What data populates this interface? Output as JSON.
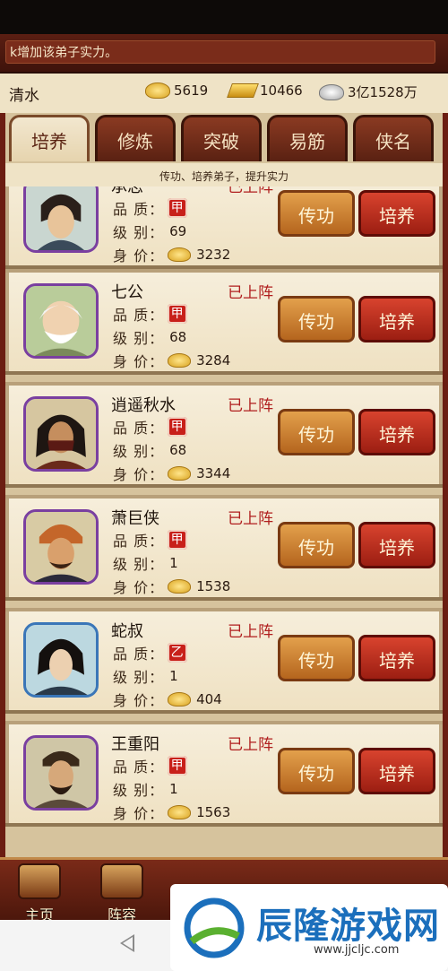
{
  "ticker": {
    "text": "k增加该弟子实力。"
  },
  "status": {
    "player_name": "清水",
    "gold_ingot": "5619",
    "gold_bar": "10466",
    "silver": "3亿1528万"
  },
  "tabs": [
    {
      "label": "培养",
      "active": true
    },
    {
      "label": "修炼"
    },
    {
      "label": "突破"
    },
    {
      "label": "易筋"
    },
    {
      "label": "侠名"
    }
  ],
  "subtitle": "传功、培养弟子，提升实力",
  "labels": {
    "quality": "品 质：",
    "level": "级 别：",
    "price": "身 价：",
    "transfer_btn": "传功",
    "train_btn": "培养"
  },
  "characters": [
    {
      "name": "承志",
      "status": "已上阵",
      "quality": "甲",
      "level": "69",
      "price": "3232"
    },
    {
      "name": "七公",
      "status": "已上阵",
      "quality": "甲",
      "level": "68",
      "price": "3284"
    },
    {
      "name": "逍遥秋水",
      "status": "已上阵",
      "quality": "甲",
      "level": "68",
      "price": "3344"
    },
    {
      "name": "萧巨侠",
      "status": "已上阵",
      "quality": "甲",
      "level": "1",
      "price": "1538"
    },
    {
      "name": "蛇叔",
      "status": "已上阵",
      "quality": "乙",
      "level": "1",
      "price": "404"
    },
    {
      "name": "王重阳",
      "status": "已上阵",
      "quality": "甲",
      "level": "1",
      "price": "1563"
    }
  ],
  "bottom_nav": [
    {
      "label": "主页",
      "icon": "house-icon"
    },
    {
      "label": "阵容",
      "icon": "team-icon"
    }
  ],
  "watermark": {
    "text": "辰隆游戏网",
    "url": "www.jjcljc.com"
  },
  "colors": {
    "accent_red": "#b01e1e",
    "frame": "#6b1d12",
    "parchment": "#efe3c6"
  }
}
